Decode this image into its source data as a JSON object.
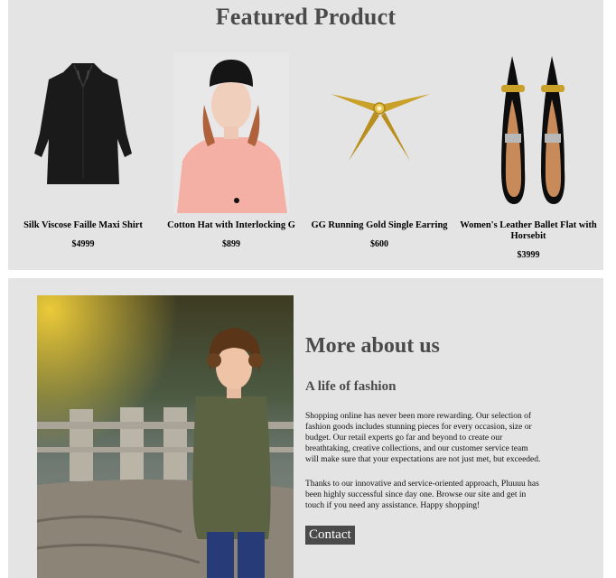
{
  "featured": {
    "title": "Featured Product",
    "products": [
      {
        "name": "Silk Viscose Faille Maxi Shirt",
        "price": "$4999",
        "image": "black-shirt-image"
      },
      {
        "name": "Cotton Hat with Interlocking G",
        "price": "$899",
        "image": "model-with-hat-image"
      },
      {
        "name": "GG Running Gold Single Earring",
        "price": "$600",
        "image": "gold-earring-image"
      },
      {
        "name": "Women's Leather Ballet Flat with Horsebit",
        "price": "$3999",
        "image": "ballet-flats-image"
      }
    ]
  },
  "about": {
    "title": "More about us",
    "subtitle": "A life of fashion",
    "paragraph1": "Shopping online has never been more rewarding. Our selection of fashion goods includes stunning pieces for every occasion, size or budget. Our retail experts go far and beyond to create our breathtaking, creative collections, and our customer service team will make sure that your expectations are not just met, but exceeded.",
    "paragraph2": "Thanks to our innovative and service-oriented approach, Pluuuu has been highly successful since day one. Browse our site and get in touch if you need any assistance. Happy shopping!",
    "contact_label": "Contact",
    "image": "child-photo-image"
  },
  "colors": {
    "section_bg": "#e4e4e4",
    "heading": "#4a4a4a",
    "button_bg": "#4a4a4a"
  }
}
